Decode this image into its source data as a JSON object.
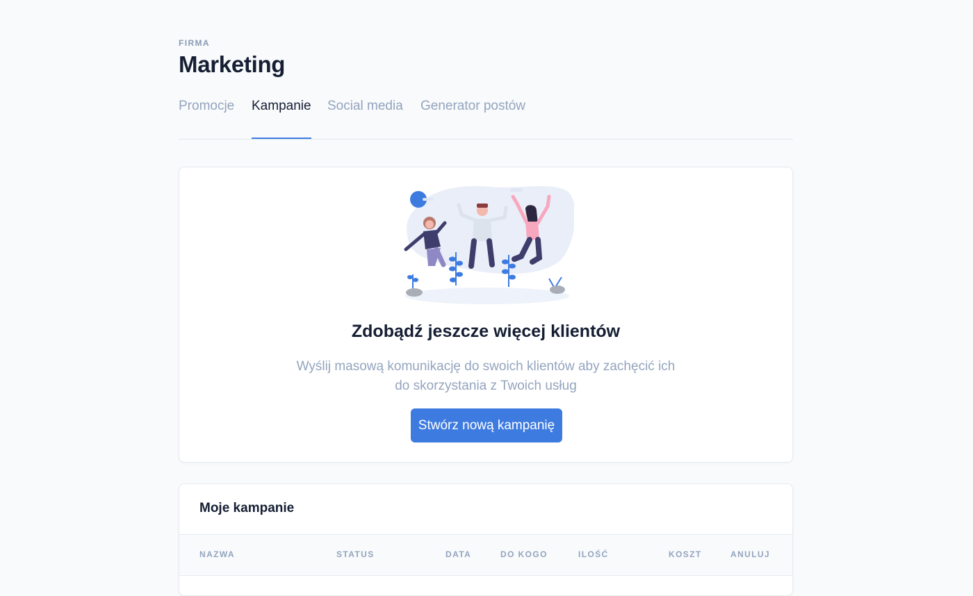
{
  "header": {
    "eyebrow": "FIRMA",
    "title": "Marketing"
  },
  "tabs": [
    {
      "label": "Promocje",
      "active": false
    },
    {
      "label": "Kampanie",
      "active": true
    },
    {
      "label": "Social media",
      "active": false
    },
    {
      "label": "Generator postów",
      "active": false
    }
  ],
  "empty_state": {
    "heading": "Zdobądź jeszcze więcej klientów",
    "description": "Wyślij masową komunikację do swoich klientów aby zachęcić ich do skorzystania z Twoich usług",
    "button_label": "Stwórz nową kampanię"
  },
  "campaigns": {
    "title": "Moje kampanie",
    "columns": [
      "NAZWA",
      "STATUS",
      "DATA",
      "DO KOGO",
      "ILOŚĆ",
      "KOSZT",
      "ANULUJ"
    ]
  },
  "colors": {
    "accent": "#3e7be0",
    "background": "#f8fafc",
    "muted_text": "#94a4be",
    "heading_text": "#151e33"
  }
}
